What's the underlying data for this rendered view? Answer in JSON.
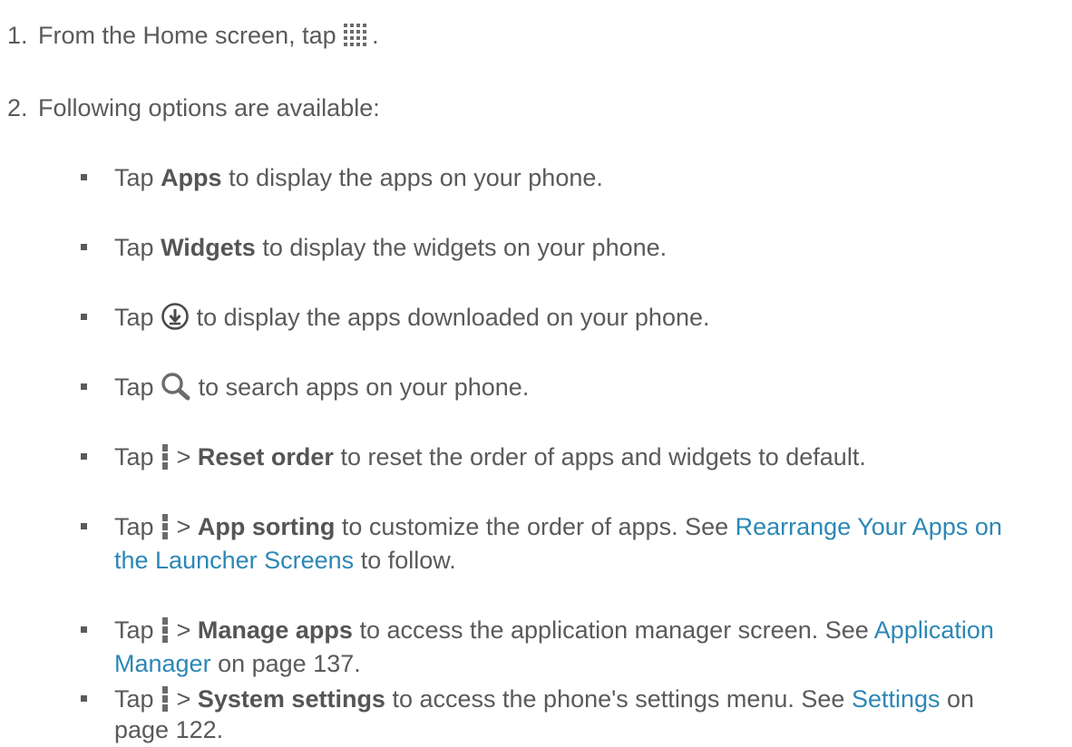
{
  "steps": [
    {
      "number": "1.",
      "before": "From the Home screen, tap",
      "after": ".",
      "icon": "apps-grid-icon"
    },
    {
      "number": "2.",
      "text": "Following options are available:"
    }
  ],
  "bullets": {
    "apps": {
      "tap": "Tap",
      "bold": "Apps",
      "rest": "to display the apps on your phone."
    },
    "widgets": {
      "tap": "Tap",
      "bold": "Widgets",
      "rest": "to display the widgets on your phone."
    },
    "download": {
      "tap": "Tap",
      "rest": "to display the apps downloaded on your phone.",
      "icon": "download-circle-icon"
    },
    "search": {
      "tap": "Tap",
      "rest": "to search apps on your phone.",
      "icon": "search-icon"
    },
    "reset": {
      "tap": "Tap",
      "gt": ">",
      "bold": "Reset order",
      "rest": "to reset the order of apps and widgets to default.",
      "icon": "menu-icon"
    },
    "sorting": {
      "tap": "Tap",
      "gt": ">",
      "bold": "App sorting",
      "rest": "to customize the order of apps. See",
      "link_line1": "Rearrange Your Apps on",
      "link_line2": "the Launcher Screens",
      "tail": "to follow.",
      "icon": "menu-icon"
    },
    "manage": {
      "tap": "Tap",
      "gt": ">",
      "bold": "Manage apps",
      "rest": "to access the application manager screen. See",
      "link_line1": "Application",
      "link_line2": "Manager",
      "tail": "on page 137.",
      "icon": "menu-icon"
    },
    "system": {
      "tap": "Tap",
      "gt": ">",
      "bold": "System settings",
      "rest": "to access the phone's settings menu. See",
      "link": "Settings",
      "tail_line1": "on",
      "tail_line2": "page 122.",
      "icon": "menu-icon"
    }
  },
  "colors": {
    "text": "#5a5a5a",
    "link": "#2c87b5"
  }
}
